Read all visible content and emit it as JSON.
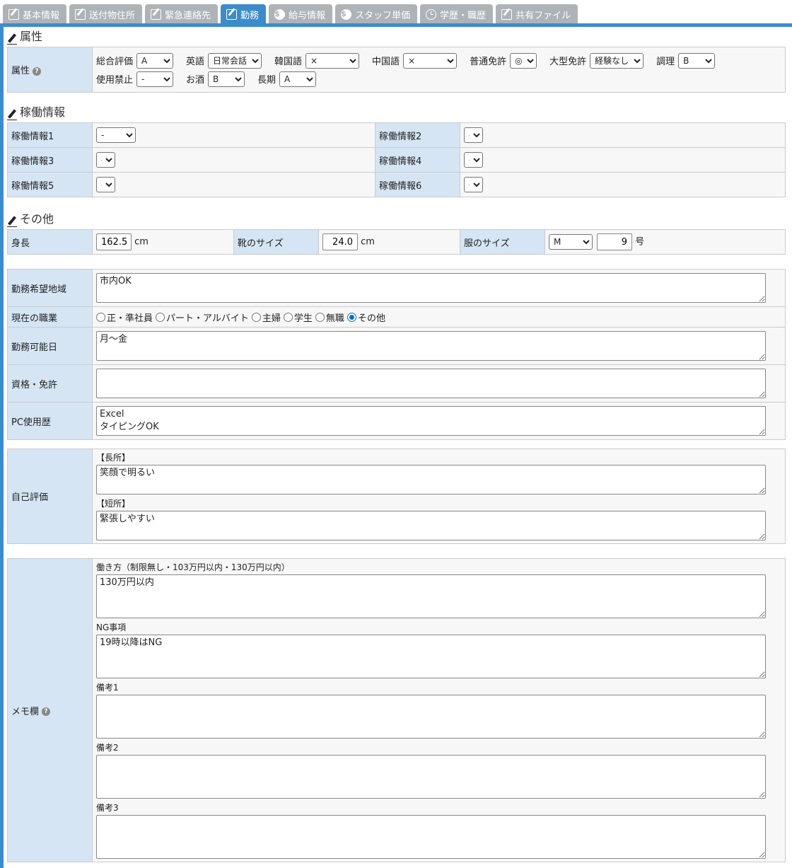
{
  "tabs": [
    {
      "label": "基本情報",
      "icon": "edit-icon",
      "active": false
    },
    {
      "label": "送付物住所",
      "icon": "edit-icon",
      "active": false
    },
    {
      "label": "緊急連絡先",
      "icon": "edit-icon",
      "active": false
    },
    {
      "label": "勤務",
      "icon": "edit-icon",
      "active": true
    },
    {
      "label": "給与情報",
      "icon": "dollar-icon",
      "active": false
    },
    {
      "label": "スタッフ単価",
      "icon": "dollar-icon",
      "active": false
    },
    {
      "label": "学歴・職歴",
      "icon": "clock-icon",
      "active": false
    },
    {
      "label": "共有ファイル",
      "icon": "edit-icon",
      "active": false
    }
  ],
  "attributes": {
    "section_title": "属性",
    "row_label": "属性",
    "items": [
      {
        "label": "総合評価",
        "value": "A"
      },
      {
        "label": "英語",
        "value": "日常会話"
      },
      {
        "label": "韓国語",
        "value": "×"
      },
      {
        "label": "中国語",
        "value": "×"
      },
      {
        "label": "普通免許",
        "value": "◎"
      },
      {
        "label": "大型免許",
        "value": "経験なし"
      },
      {
        "label": "調理",
        "value": "B"
      },
      {
        "label": "使用禁止",
        "value": "-"
      },
      {
        "label": "お酒",
        "value": "B"
      },
      {
        "label": "長期",
        "value": "A"
      }
    ]
  },
  "operation": {
    "section_title": "稼働情報",
    "items": [
      {
        "label": "稼働情報1",
        "value": "-"
      },
      {
        "label": "稼働情報2",
        "value": "-"
      },
      {
        "label": "稼働情報3",
        "value": "-"
      },
      {
        "label": "稼働情報4",
        "value": "-"
      },
      {
        "label": "稼働情報5",
        "value": "-"
      },
      {
        "label": "稼働情報6",
        "value": "-"
      }
    ]
  },
  "other": {
    "section_title": "その他",
    "height_label": "身長",
    "height_value": "162.5",
    "height_unit": "cm",
    "shoe_label": "靴のサイズ",
    "shoe_value": "24.0",
    "shoe_unit": "cm",
    "clothes_label": "服のサイズ",
    "clothes_value": "M",
    "clothes_number": "9",
    "clothes_unit": "号"
  },
  "work": {
    "area_label": "勤務希望地域",
    "area_value": "市内OK",
    "job_label": "現在の職業",
    "job_options": [
      "正・準社員",
      "パート・アルバイト",
      "主婦",
      "学生",
      "無職",
      "その他"
    ],
    "job_selected": "その他",
    "days_label": "勤務可能日",
    "days_value": "月～金",
    "license_label": "資格・免許",
    "license_value": "",
    "pc_label": "PC使用歴",
    "pc_value": "Excel\nタイピングOK"
  },
  "self_eval": {
    "label": "自己評価",
    "strength_label": "【長所】",
    "strength_value": "笑顔で明るい",
    "weakness_label": "【短所】",
    "weakness_value": "緊張しやすい"
  },
  "memo": {
    "label": "メモ欄",
    "work_style_label": "働き方（制限無し・103万円以内・130万円以内）",
    "work_style_value": "130万円以内",
    "ng_label": "NG事項",
    "ng_value": "19時以降はNG",
    "note1_label": "備考1",
    "note1_value": "",
    "note2_label": "備考2",
    "note2_value": "",
    "note3_label": "備考3",
    "note3_value": ""
  },
  "colors": {
    "active_tab": "#3c8ccc",
    "inactive_tab": "#aeb3b7",
    "label_bg": "#d5e5f4"
  }
}
